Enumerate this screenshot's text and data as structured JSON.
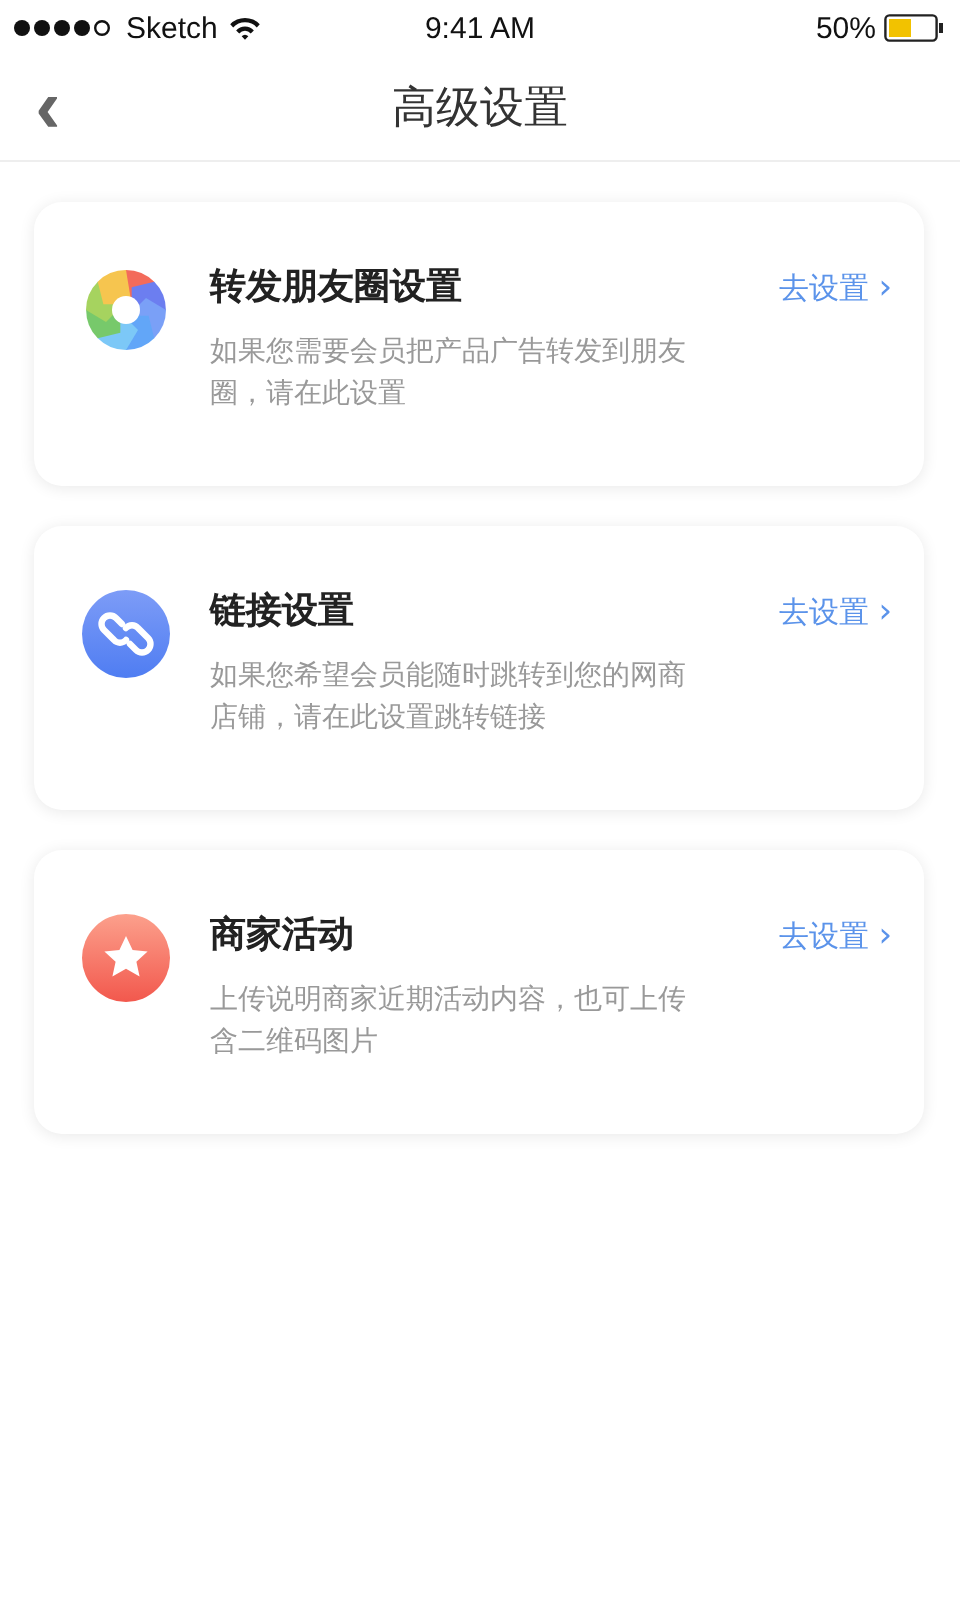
{
  "status_bar": {
    "carrier": "Sketch",
    "time": "9:41 AM",
    "battery": "50%"
  },
  "header": {
    "back": "‹",
    "title": "高级设置"
  },
  "cards": [
    {
      "kind": "aperture",
      "title": "转发朋友圈设置",
      "description": "如果您需要会员把产品广告转发到朋友圈，请在此设置",
      "action": "去设置",
      "chevron": "›"
    },
    {
      "kind": "link",
      "title": "链接设置",
      "description": "如果您希望会员能随时跳转到您的网商店铺，请在此设置跳转链接",
      "action": "去设置",
      "chevron": "›"
    },
    {
      "kind": "star",
      "title": "商家活动",
      "description": "上传说明商家近期活动内容，也可上传含二维码图片",
      "action": "去设置",
      "chevron": "›"
    }
  ]
}
